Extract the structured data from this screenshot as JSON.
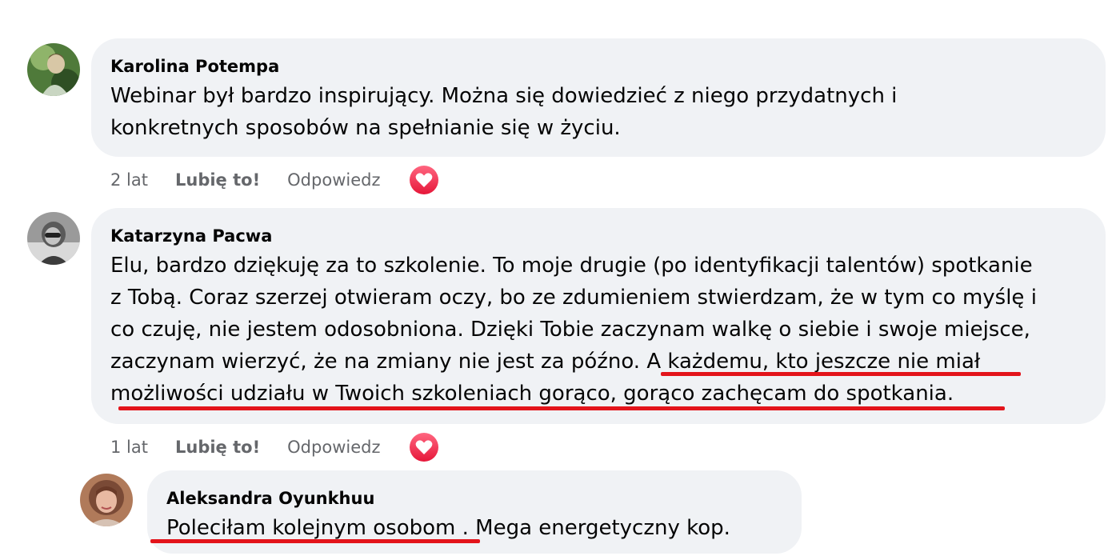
{
  "comments": [
    {
      "author": "Karolina Potempa",
      "lines": [
        "Webinar był bardzo inspirujący. Można się dowiedzieć z niego przydatnych i",
        "konkretnych sposobów na spełnianie się w życiu."
      ],
      "time": "2 lat",
      "like_label": "Lubię to!",
      "reply_label": "Odpowiedz",
      "reaction": "heart-icon"
    },
    {
      "author": "Katarzyna Pacwa",
      "lines": [
        "Elu, bardzo dziękuję za to szkolenie. To moje drugie (po identyfikacji talentów) spotkanie",
        "z Tobą. Coraz szerzej otwieram oczy, bo ze zdumieniem stwierdzam, że w tym co myślę i",
        "co czuję, nie jestem odosobniona. Dzięki Tobie zaczynam walkę o siebie i swoje miejsce,",
        "zaczynam wierzyć, że na zmiany nie jest za późno. A każdemu, kto jeszcze nie miał",
        "możliwości udziału w Twoich szkoleniach gorąco, gorąco zachęcam do spotkania."
      ],
      "time": "1 lat",
      "like_label": "Lubię to!",
      "reply_label": "Odpowiedz",
      "reaction": "heart-icon"
    }
  ],
  "reply": {
    "author": "Aleksandra Oyunkhuu",
    "text": "Poleciłam kolejnym osobom . Mega energetyczny kop."
  },
  "colors": {
    "bubble": "#f0f2f5",
    "meta_text": "#65676b",
    "underline": "#e3141b",
    "reaction_start": "#ff6680",
    "reaction_end": "#e61739"
  }
}
